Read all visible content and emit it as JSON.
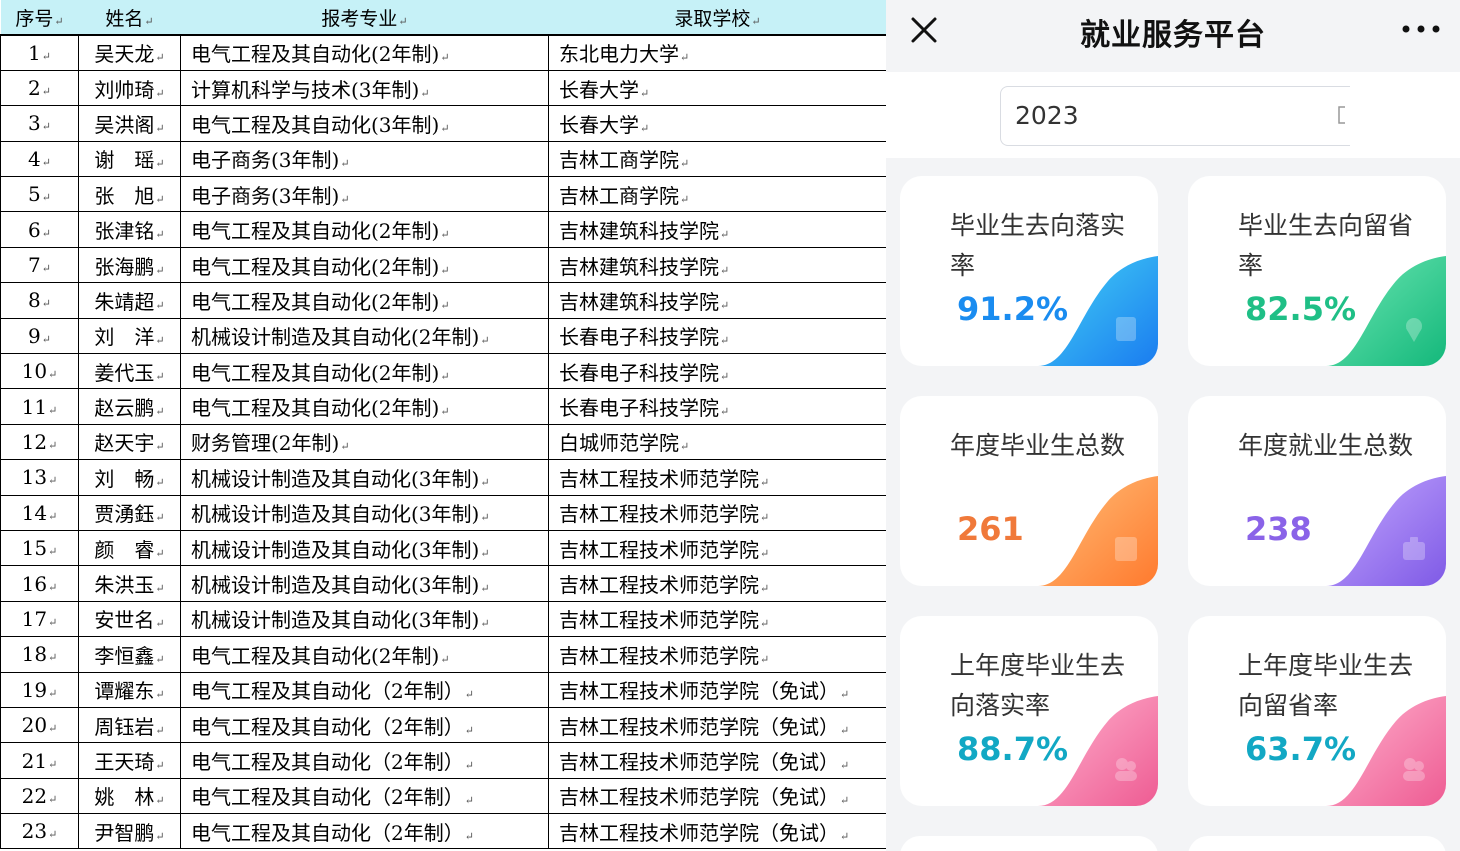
{
  "table": {
    "headers": {
      "no": "序号",
      "name": "姓名",
      "major": "报考专业",
      "school": "录取学校"
    },
    "paragraph_mark": "↵",
    "rows": [
      {
        "no": "1",
        "name": "吴天龙",
        "major": "电气工程及其自动化(2年制)",
        "school": "东北电力大学"
      },
      {
        "no": "2",
        "name": "刘帅琦",
        "major": "计算机科学与技术(3年制)",
        "school": "长春大学"
      },
      {
        "no": "3",
        "name": "吴洪阁",
        "major": "电气工程及其自动化(3年制)",
        "school": "长春大学"
      },
      {
        "no": "4",
        "name": "谢　瑶",
        "major": "电子商务(3年制)",
        "school": "吉林工商学院"
      },
      {
        "no": "5",
        "name": "张　旭",
        "major": "电子商务(3年制)",
        "school": "吉林工商学院"
      },
      {
        "no": "6",
        "name": "张津铭",
        "major": "电气工程及其自动化(2年制)",
        "school": "吉林建筑科技学院"
      },
      {
        "no": "7",
        "name": "张海鹏",
        "major": "电气工程及其自动化(2年制)",
        "school": "吉林建筑科技学院"
      },
      {
        "no": "8",
        "name": "朱靖超",
        "major": "电气工程及其自动化(2年制)",
        "school": "吉林建筑科技学院"
      },
      {
        "no": "9",
        "name": "刘　洋",
        "major": "机械设计制造及其自动化(2年制)",
        "school": "长春电子科技学院"
      },
      {
        "no": "10",
        "name": "姜代玉",
        "major": "电气工程及其自动化(2年制)",
        "school": "长春电子科技学院"
      },
      {
        "no": "11",
        "name": "赵云鹏",
        "major": "电气工程及其自动化(2年制)",
        "school": "长春电子科技学院"
      },
      {
        "no": "12",
        "name": "赵天宇",
        "major": "财务管理(2年制)",
        "school": "白城师范学院"
      },
      {
        "no": "13",
        "name": "刘　畅",
        "major": "机械设计制造及其自动化(3年制)",
        "school": "吉林工程技术师范学院"
      },
      {
        "no": "14",
        "name": "贾湧鈺",
        "major": "机械设计制造及其自动化(3年制)",
        "school": "吉林工程技术师范学院"
      },
      {
        "no": "15",
        "name": "颜　睿",
        "major": "机械设计制造及其自动化(3年制)",
        "school": "吉林工程技术师范学院"
      },
      {
        "no": "16",
        "name": "朱洪玉",
        "major": "机械设计制造及其自动化(3年制)",
        "school": "吉林工程技术师范学院"
      },
      {
        "no": "17",
        "name": "安世名",
        "major": "机械设计制造及其自动化(3年制)",
        "school": "吉林工程技术师范学院"
      },
      {
        "no": "18",
        "name": "李恒鑫",
        "major": "电气工程及其自动化(2年制)",
        "school": "吉林工程技术师范学院"
      },
      {
        "no": "19",
        "name": "谭耀东",
        "major": "电气工程及其自动化（2年制）",
        "school": "吉林工程技术师范学院（免试）"
      },
      {
        "no": "20",
        "name": "周钰岩",
        "major": "电气工程及其自动化（2年制）",
        "school": "吉林工程技术师范学院（免试）"
      },
      {
        "no": "21",
        "name": "王天琦",
        "major": "电气工程及其自动化（2年制）",
        "school": "吉林工程技术师范学院（免试）"
      },
      {
        "no": "22",
        "name": "姚　林",
        "major": "电气工程及其自动化（2年制）",
        "school": "吉林工程技术师范学院（免试）"
      },
      {
        "no": "23",
        "name": "尹智鹏",
        "major": "电气工程及其自动化（2年制）",
        "school": "吉林工程技术师范学院（免试）"
      }
    ]
  },
  "app": {
    "title": "就业服务平台",
    "close_icon": "close-icon",
    "more_icon": "more-dots-icon",
    "year_value": "2023",
    "cards": [
      {
        "label": "毕业生去向落实率",
        "value": "91.2%",
        "color": "#1a8cf0",
        "deco_from": "#45d4f5",
        "deco_to": "#1a7cf0",
        "icon": "document-icon"
      },
      {
        "label": "毕业生去向留省率",
        "value": "82.5%",
        "color": "#1fbf86",
        "deco_from": "#6fe7b4",
        "deco_to": "#14b87b",
        "icon": "location-icon"
      },
      {
        "label": "年度毕业生总数",
        "value": "261",
        "color": "#f0793a",
        "deco_from": "#ffc07a",
        "deco_to": "#ff7a2e",
        "icon": "chart-icon"
      },
      {
        "label": "年度就业生总数",
        "value": "238",
        "color": "#8a63e8",
        "deco_from": "#c5a9ff",
        "deco_to": "#7f5ae6",
        "icon": "briefcase-icon"
      },
      {
        "label": "上年度毕业生去向落实率",
        "value": "88.7%",
        "color": "#12a8c4",
        "deco_from": "#ffb3cf",
        "deco_to": "#ee5c93",
        "icon": "users-icon"
      },
      {
        "label": "上年度毕业生去向留省率",
        "value": "63.7%",
        "color": "#12a8c4",
        "deco_from": "#ffb3cf",
        "deco_to": "#ee5c93",
        "icon": "users-icon"
      }
    ]
  }
}
